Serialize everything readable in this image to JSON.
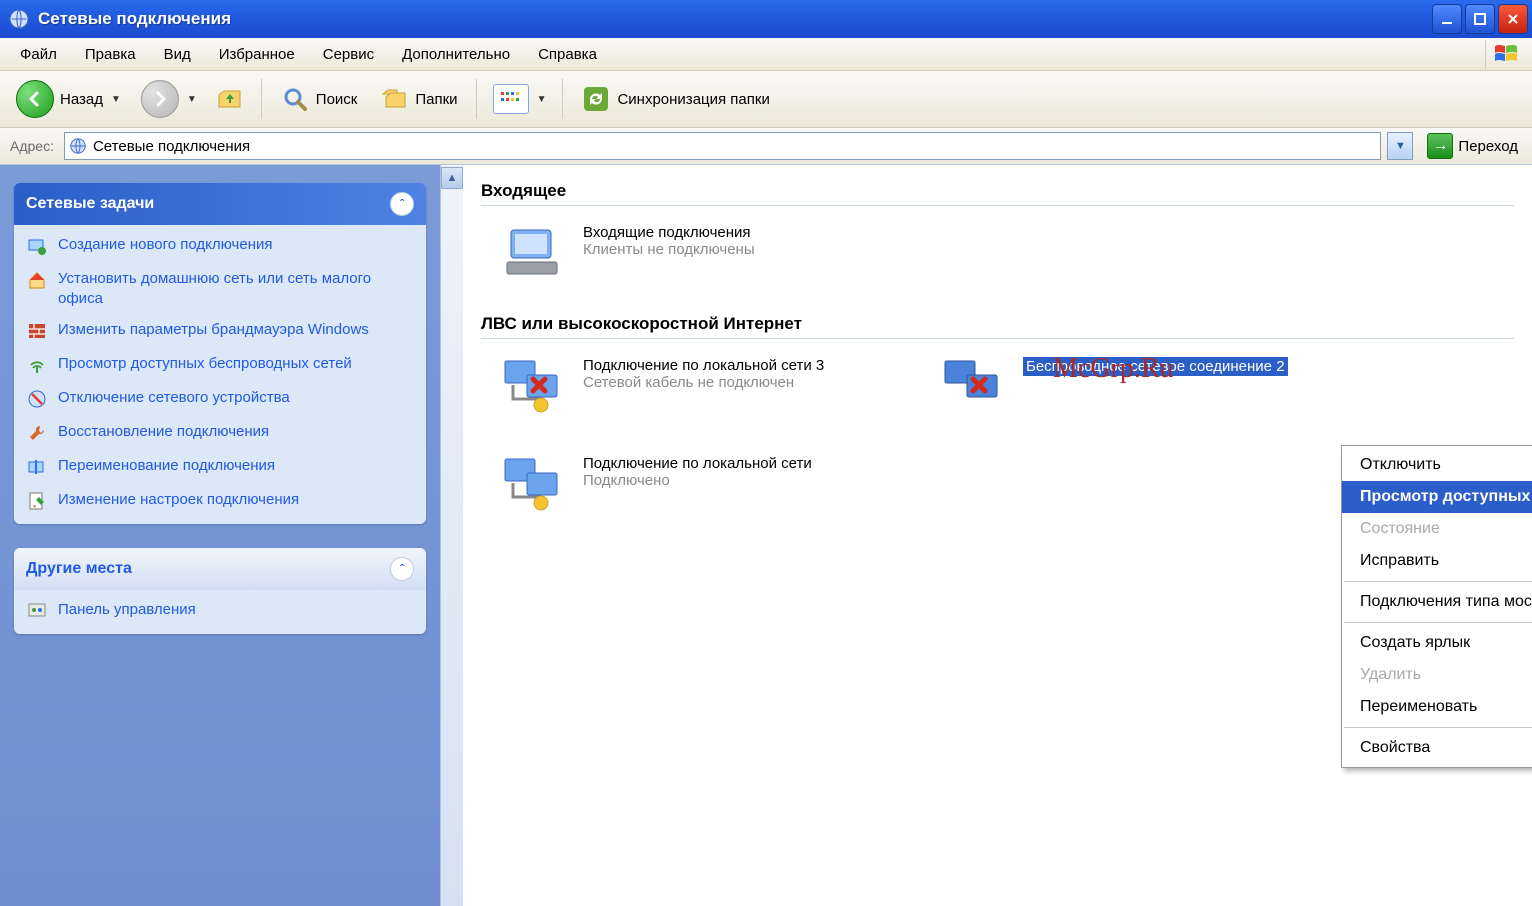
{
  "window": {
    "title": "Сетевые подключения"
  },
  "menu": {
    "items": [
      "Файл",
      "Правка",
      "Вид",
      "Избранное",
      "Сервис",
      "Дополнительно",
      "Справка"
    ]
  },
  "toolbar": {
    "back": "Назад",
    "search": "Поиск",
    "folders": "Папки",
    "sync": "Синхронизация папки"
  },
  "address": {
    "label": "Адрес:",
    "value": "Сетевые подключения",
    "go": "Переход"
  },
  "sidebar": {
    "panel1": {
      "title": "Сетевые задачи",
      "tasks": [
        "Создание нового подключения",
        "Установить домашнюю сеть или сеть малого офиса",
        "Изменить параметры брандмауэра Windows",
        "Просмотр доступных беспроводных сетей",
        "Отключение сетевого устройства",
        "Восстановление подключения",
        "Переименование подключения",
        "Изменение настроек подключения"
      ]
    },
    "panel2": {
      "title": "Другие места",
      "items": [
        "Панель управления"
      ]
    }
  },
  "content": {
    "group1": {
      "header": "Входящее",
      "item": {
        "name": "Входящие подключения",
        "sub": "Клиенты не подключены"
      }
    },
    "group2": {
      "header": "ЛВС или высокоскоростной Интернет",
      "items": [
        {
          "name": "Подключение по локальной сети 3",
          "sub": "Сетевой кабель не подключен"
        },
        {
          "name": "Подключение по локальной сети",
          "sub": "Подключено"
        },
        {
          "name": "Беспроводное сетевое соединение 2",
          "sub": ""
        }
      ]
    }
  },
  "watermark": "McGrp.Ru",
  "context_menu": {
    "items": [
      {
        "label": "Отключить",
        "disabled": false
      },
      {
        "label": "Просмотр доступных беспроводных сетей",
        "highlight": true
      },
      {
        "label": "Состояние",
        "disabled": true
      },
      {
        "label": "Исправить",
        "disabled": false
      },
      {
        "sep": true
      },
      {
        "label": "Подключения типа мост",
        "disabled": false
      },
      {
        "sep": true
      },
      {
        "label": "Создать ярлык",
        "disabled": false
      },
      {
        "label": "Удалить",
        "disabled": true
      },
      {
        "label": "Переименовать",
        "disabled": false
      },
      {
        "sep": true
      },
      {
        "label": "Свойства",
        "disabled": false
      }
    ]
  }
}
